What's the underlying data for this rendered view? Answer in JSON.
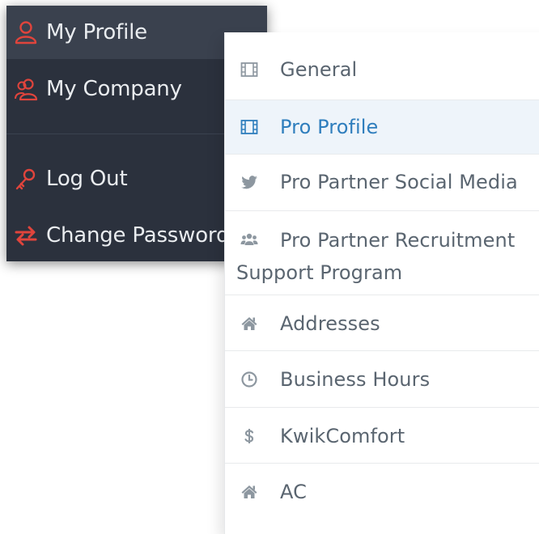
{
  "user_menu": {
    "items": [
      {
        "label": "My Profile",
        "icon": "user-icon"
      },
      {
        "label": "My Company",
        "icon": "users-icon"
      },
      {
        "label": "Log Out",
        "icon": "key-icon"
      },
      {
        "label": "Change Password",
        "icon": "exchange-arrows-icon"
      }
    ],
    "icon_color": "#e0443c",
    "background": "#2b313d",
    "active_background": "#3a414e"
  },
  "settings_nav": {
    "items": [
      {
        "label": "General",
        "icon": "film-icon"
      },
      {
        "label": "Pro Profile",
        "icon": "film-icon",
        "active": true
      },
      {
        "label": "Pro Partner Social Media",
        "icon": "twitter-icon"
      },
      {
        "label_line1": "Pro Partner Recruitment",
        "label_line2": "Support Program",
        "icon": "group-icon"
      },
      {
        "label": "Addresses",
        "icon": "home-icon"
      },
      {
        "label": "Business Hours",
        "icon": "clock-icon"
      },
      {
        "label": "KwikComfort",
        "icon": "dollar-icon"
      },
      {
        "label": "AC",
        "icon": "home-icon"
      }
    ],
    "text_color": "#5a6570",
    "active_color": "#2f7ebd",
    "icon_color": "#8d97a0"
  }
}
